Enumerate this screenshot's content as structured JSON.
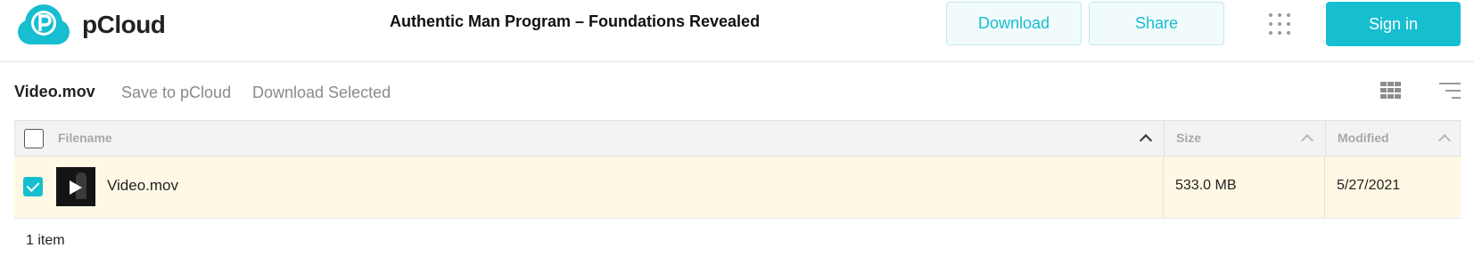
{
  "app": {
    "logo_text": "pCloud",
    "logo_icon": "pcloud-cloud-logo",
    "document_title": "Authentic Man Program – Foundations Revealed",
    "accent_color": "#17bed0"
  },
  "header": {
    "download_label": "Download",
    "share_label": "Share",
    "apps_icon": "grid-dots-icon",
    "signin_label": "Sign in"
  },
  "toolbar": {
    "title": "Video.mov",
    "save_label": "Save to pCloud",
    "download_selected_label": "Download Selected",
    "view_icon": "grid-view-icon",
    "sort_icon": "sort-icon"
  },
  "table": {
    "columns": {
      "filename": "Filename",
      "size": "Size",
      "modified": "Modified"
    },
    "rows": [
      {
        "selected": true,
        "name": "Video.mov",
        "size": "533.0 MB",
        "modified": "5/27/2021",
        "thumbnail": "video-thumbnail"
      }
    ]
  },
  "footer": {
    "item_count": "1 item"
  }
}
